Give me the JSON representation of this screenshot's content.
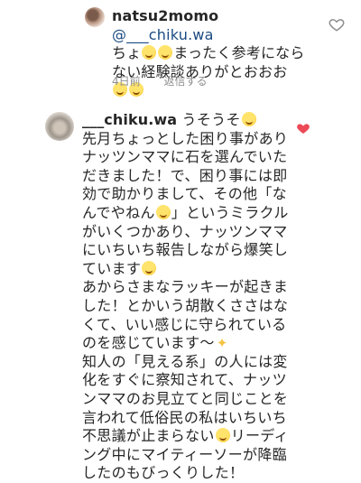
{
  "comment_1": {
    "username": "natsu2momo",
    "mention": "@___chiku.wa",
    "text_a": "ちょ",
    "text_b": "まったく参考になら ない経験談ありがとおおお",
    "time": "4日前",
    "reply": "返信する",
    "icons": {
      "avatar": "avatar",
      "like": "heart-outline-icon",
      "emoji": "rolling-laugh-emoji"
    }
  },
  "comment_2": {
    "username": "___chiku.wa",
    "text_intro": " うそうそ",
    "para_1_a": "先月ちょっとした困り事がありナッツンママに石を選んでいただきました！で、困り事には即効で助かりまして、その他「なんでやねん",
    "para_1_b": "」というミラクルがいくつかあり、ナッツンママにいちいち報告しながら爆笑しています",
    "para_2_a": "あからさまなラッキーが起きました！とかいう胡散くささはなくて、いい感じに守られているのを感じています〜",
    "para_3_a": "知人の「見える系」の人には変化をすぐに察知されて、ナッツンママのお見立てと同じことを言われて低俗民の私はいちいち不思議が止まらない",
    "para_3_b": "リーディング中にマイティーソーが降臨したのもびっくりした！",
    "icons": {
      "avatar": "avatar",
      "like": "heart-filled-icon",
      "sparkle": "sparkles-emoji"
    }
  },
  "colors": {
    "like_active": "#ed4956",
    "mention": "#1a4b82",
    "meta": "#8e8e8e"
  }
}
